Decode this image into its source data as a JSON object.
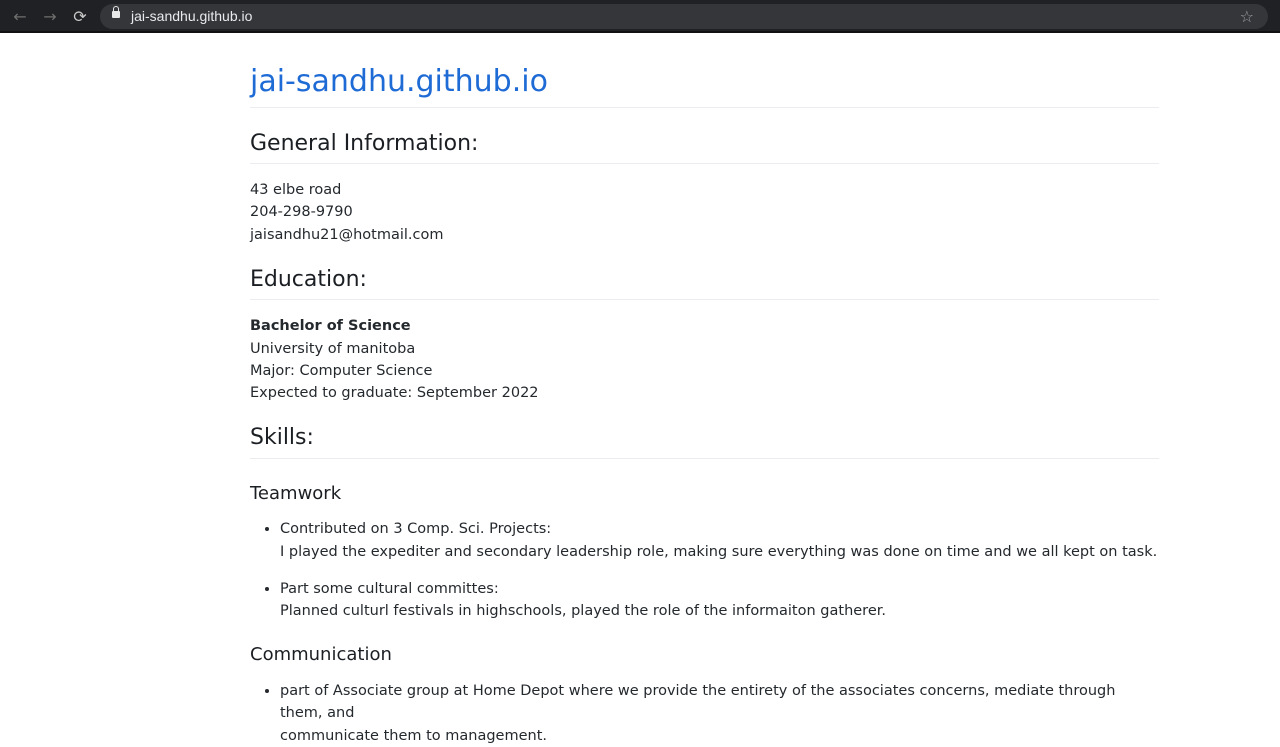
{
  "browser": {
    "url": "jai-sandhu.github.io"
  },
  "page": {
    "title": "jai-sandhu.github.io",
    "general": {
      "heading": "General Information:",
      "address": "43 elbe road",
      "phone": "204-298-9790",
      "email": "jaisandhu21@hotmail.com"
    },
    "education": {
      "heading": "Education:",
      "degree": "Bachelor of Science",
      "university": "University of manitoba",
      "major": "Major: Computer Science",
      "graduation": "Expected to graduate: September 2022"
    },
    "skills": {
      "heading": "Skills:",
      "teamwork": {
        "heading": "Teamwork",
        "items": [
          {
            "title": "Contributed on 3 Comp. Sci. Projects:",
            "detail": "I played the expediter and secondary leadership role, making sure everything was done on time and we all kept on task."
          },
          {
            "title": "Part some cultural committes:",
            "detail": "Planned culturl festivals in highschools, played the role of the informaiton gatherer."
          }
        ]
      },
      "communication": {
        "heading": "Communication",
        "items": [
          {
            "line1": "part of Associate group at Home Depot where we provide the entirety of the associates concerns, mediate through them, and",
            "line2": "communicate them to management."
          }
        ]
      }
    }
  }
}
